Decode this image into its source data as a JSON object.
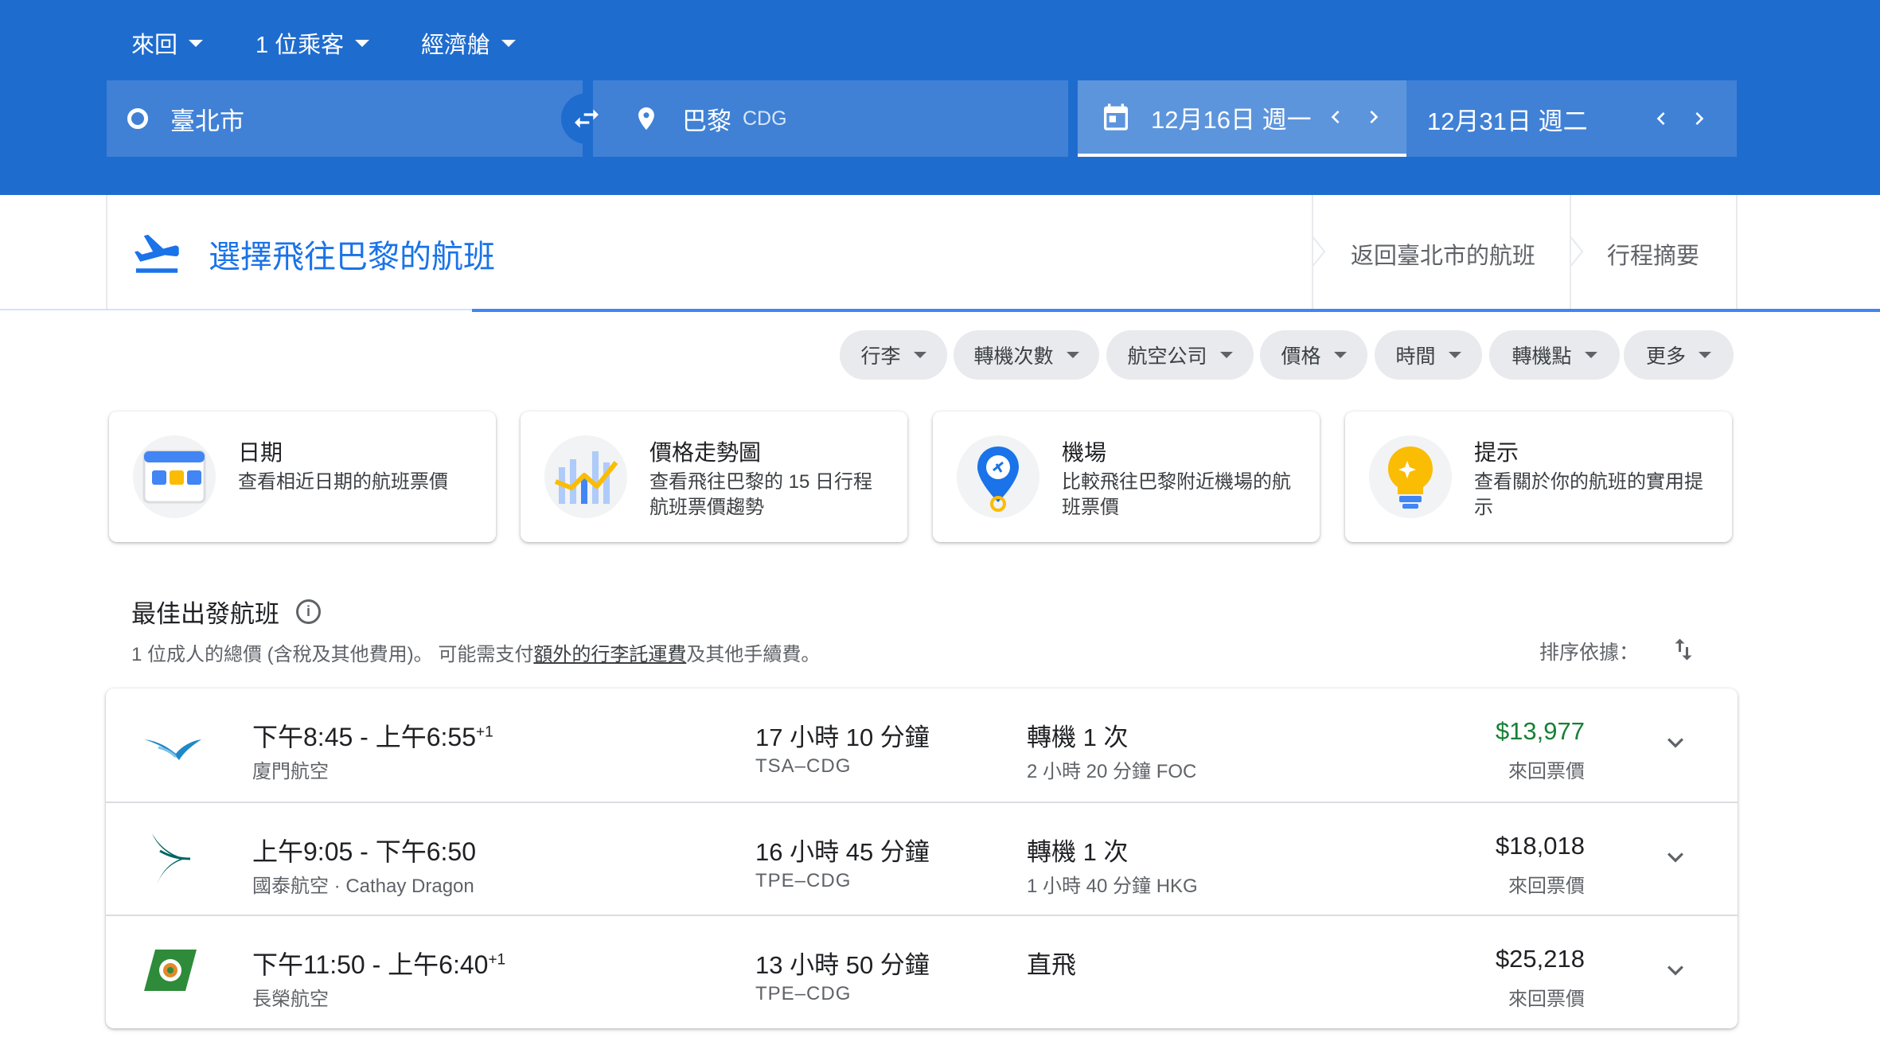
{
  "header": {
    "trip_type": "來回",
    "passengers": "1 位乘客",
    "cabin": "經濟艙",
    "origin": "臺北市",
    "destination": "巴黎",
    "destination_code": "CDG",
    "depart_date": "12月16日 週一",
    "return_date": "12月31日 週二",
    "colors": {
      "brand_blue": "#1f6ccf",
      "accent_blue": "#1a73e8",
      "price_green": "#188038"
    }
  },
  "steps": {
    "current": "選擇飛往巴黎的航班",
    "return": "返回臺北市的航班",
    "summary": "行程摘要"
  },
  "filters": [
    "行李",
    "轉機次數",
    "航空公司",
    "價格",
    "時間",
    "轉機點",
    "更多"
  ],
  "insights": [
    {
      "title": "日期",
      "desc": "查看相近日期的航班票價",
      "icon": "calendar-icon"
    },
    {
      "title": "價格走勢圖",
      "desc": "查看飛往巴黎的 15 日行程航班票價趨勢",
      "icon": "price-graph-icon"
    },
    {
      "title": "機場",
      "desc": "比較飛往巴黎附近機場的航班票價",
      "icon": "airport-pin-icon"
    },
    {
      "title": "提示",
      "desc": "查看關於你的航班的實用提示",
      "icon": "lightbulb-icon"
    }
  ],
  "results": {
    "title": "最佳出發航班",
    "subtitle_pre": "1 位成人的總價 (含稅及其他費用)。 可能需支付",
    "subtitle_link": "額外的行李託運費",
    "subtitle_post": "及其他手續費。",
    "sort_label": "排序依據：",
    "flights": [
      {
        "times": "下午8:45 - 上午6:55",
        "plus_day": "+1",
        "airline": "廈門航空",
        "duration": "17 小時 10 分鐘",
        "route": "TSA–CDG",
        "stops": "轉機 1 次",
        "layover": "2 小時 20 分鐘 FOC",
        "price": "$13,977",
        "price_type": "來回票價",
        "logo": "xiamen-airlines-logo"
      },
      {
        "times": "上午9:05 - 下午6:50",
        "plus_day": "",
        "airline": "國泰航空 · Cathay Dragon",
        "duration": "16 小時 45 分鐘",
        "route": "TPE–CDG",
        "stops": "轉機 1 次",
        "layover": "1 小時 40 分鐘 HKG",
        "price": "$18,018",
        "price_type": "來回票價",
        "logo": "cathay-pacific-logo"
      },
      {
        "times": "下午11:50 - 上午6:40",
        "plus_day": "+1",
        "airline": "長榮航空",
        "duration": "13 小時 50 分鐘",
        "route": "TPE–CDG",
        "stops": "直飛",
        "layover": "",
        "price": "$25,218",
        "price_type": "來回票價",
        "logo": "eva-air-logo"
      }
    ]
  }
}
